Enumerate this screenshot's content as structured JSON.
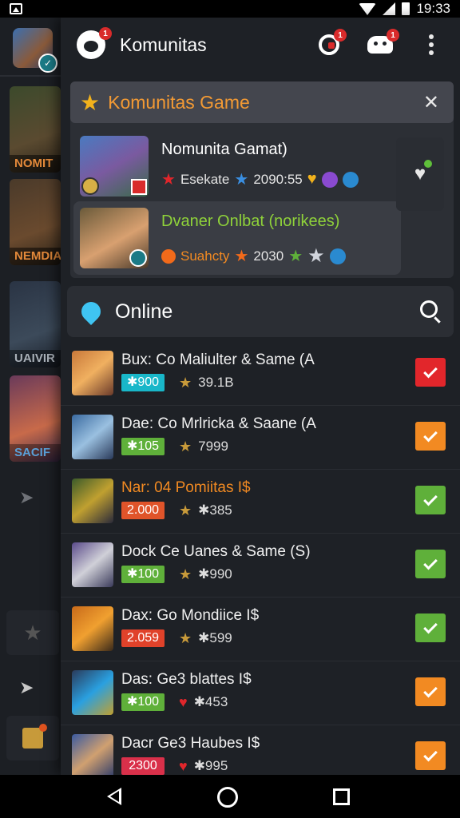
{
  "status_bar": {
    "time": "19:33",
    "icons": [
      "gallery-icon",
      "wifi-icon",
      "signal-icon",
      "battery-icon"
    ]
  },
  "sidebar": {
    "tiles": [
      {
        "label": "NOMIT",
        "label_color": "#e3893a"
      },
      {
        "label": "NEMDIA",
        "label_color": "#e3893a"
      },
      {
        "label": "UAIVIR",
        "label_color": "#a9b0b8"
      },
      {
        "label": "SACIF",
        "label_color": "#5aa0d8"
      }
    ]
  },
  "topbar": {
    "title": "Komunitas",
    "app_badge": "1",
    "g_badge": "1",
    "pad_badge": "1"
  },
  "featured": {
    "header": "Komunitas Game",
    "games": [
      {
        "name": "Nomunita Gamat)",
        "meta_text": "Esekate",
        "time": "2090:55"
      },
      {
        "name": "Dvaner Onlbat (norikees)",
        "meta_text": "Suahcty",
        "time": "2030"
      }
    ]
  },
  "online": {
    "label": "Online"
  },
  "list": [
    {
      "name": "Bux: Co Maliulter & Same (A",
      "name_color": "#f0f0f0",
      "tag": "900",
      "tag_prefix": "✱",
      "tag_color": "#19b7c9",
      "stat_icon": "★",
      "stat": "39.1B",
      "check_color": "#e2262b"
    },
    {
      "name": "Dae: Co Mrlricka & Saane (A",
      "name_color": "#f0f0f0",
      "tag": "105",
      "tag_prefix": "✱",
      "tag_color": "#5fb03a",
      "stat_icon": "★",
      "stat": "7999",
      "check_color": "#f28a22"
    },
    {
      "name": "Nar: 04 Pomiitas I$",
      "name_color": "#f28a22",
      "tag": "2.000",
      "tag_prefix": "",
      "tag_color": "#e0542a",
      "stat_icon": "★",
      "stat": "✱385",
      "check_color": "#5fb03a"
    },
    {
      "name": "Dock Ce Uanes & Same (S)",
      "name_color": "#f0f0f0",
      "tag": "100",
      "tag_prefix": "✱",
      "tag_color": "#5fb03a",
      "stat_icon": "★",
      "stat": "✱990",
      "check_color": "#5fb03a"
    },
    {
      "name": "Dax: Go Mondiice I$",
      "name_color": "#f0f0f0",
      "tag": "2.059",
      "tag_prefix": "",
      "tag_color": "#e0422a",
      "stat_icon": "★",
      "stat": "✱599",
      "check_color": "#5fb03a"
    },
    {
      "name": "Das: Ge3 blattes I$",
      "name_color": "#f0f0f0",
      "tag": "100",
      "tag_prefix": "✱",
      "tag_color": "#5fb03a",
      "stat_icon": "♥",
      "stat": "✱453",
      "check_color": "#f28a22"
    },
    {
      "name": "Dacr Ge3 Haubes I$",
      "name_color": "#f0f0f0",
      "tag": "2300",
      "tag_prefix": "",
      "tag_color": "#d9304a",
      "stat_icon": "♥",
      "stat": "✱995",
      "check_color": "#f28a22"
    }
  ]
}
